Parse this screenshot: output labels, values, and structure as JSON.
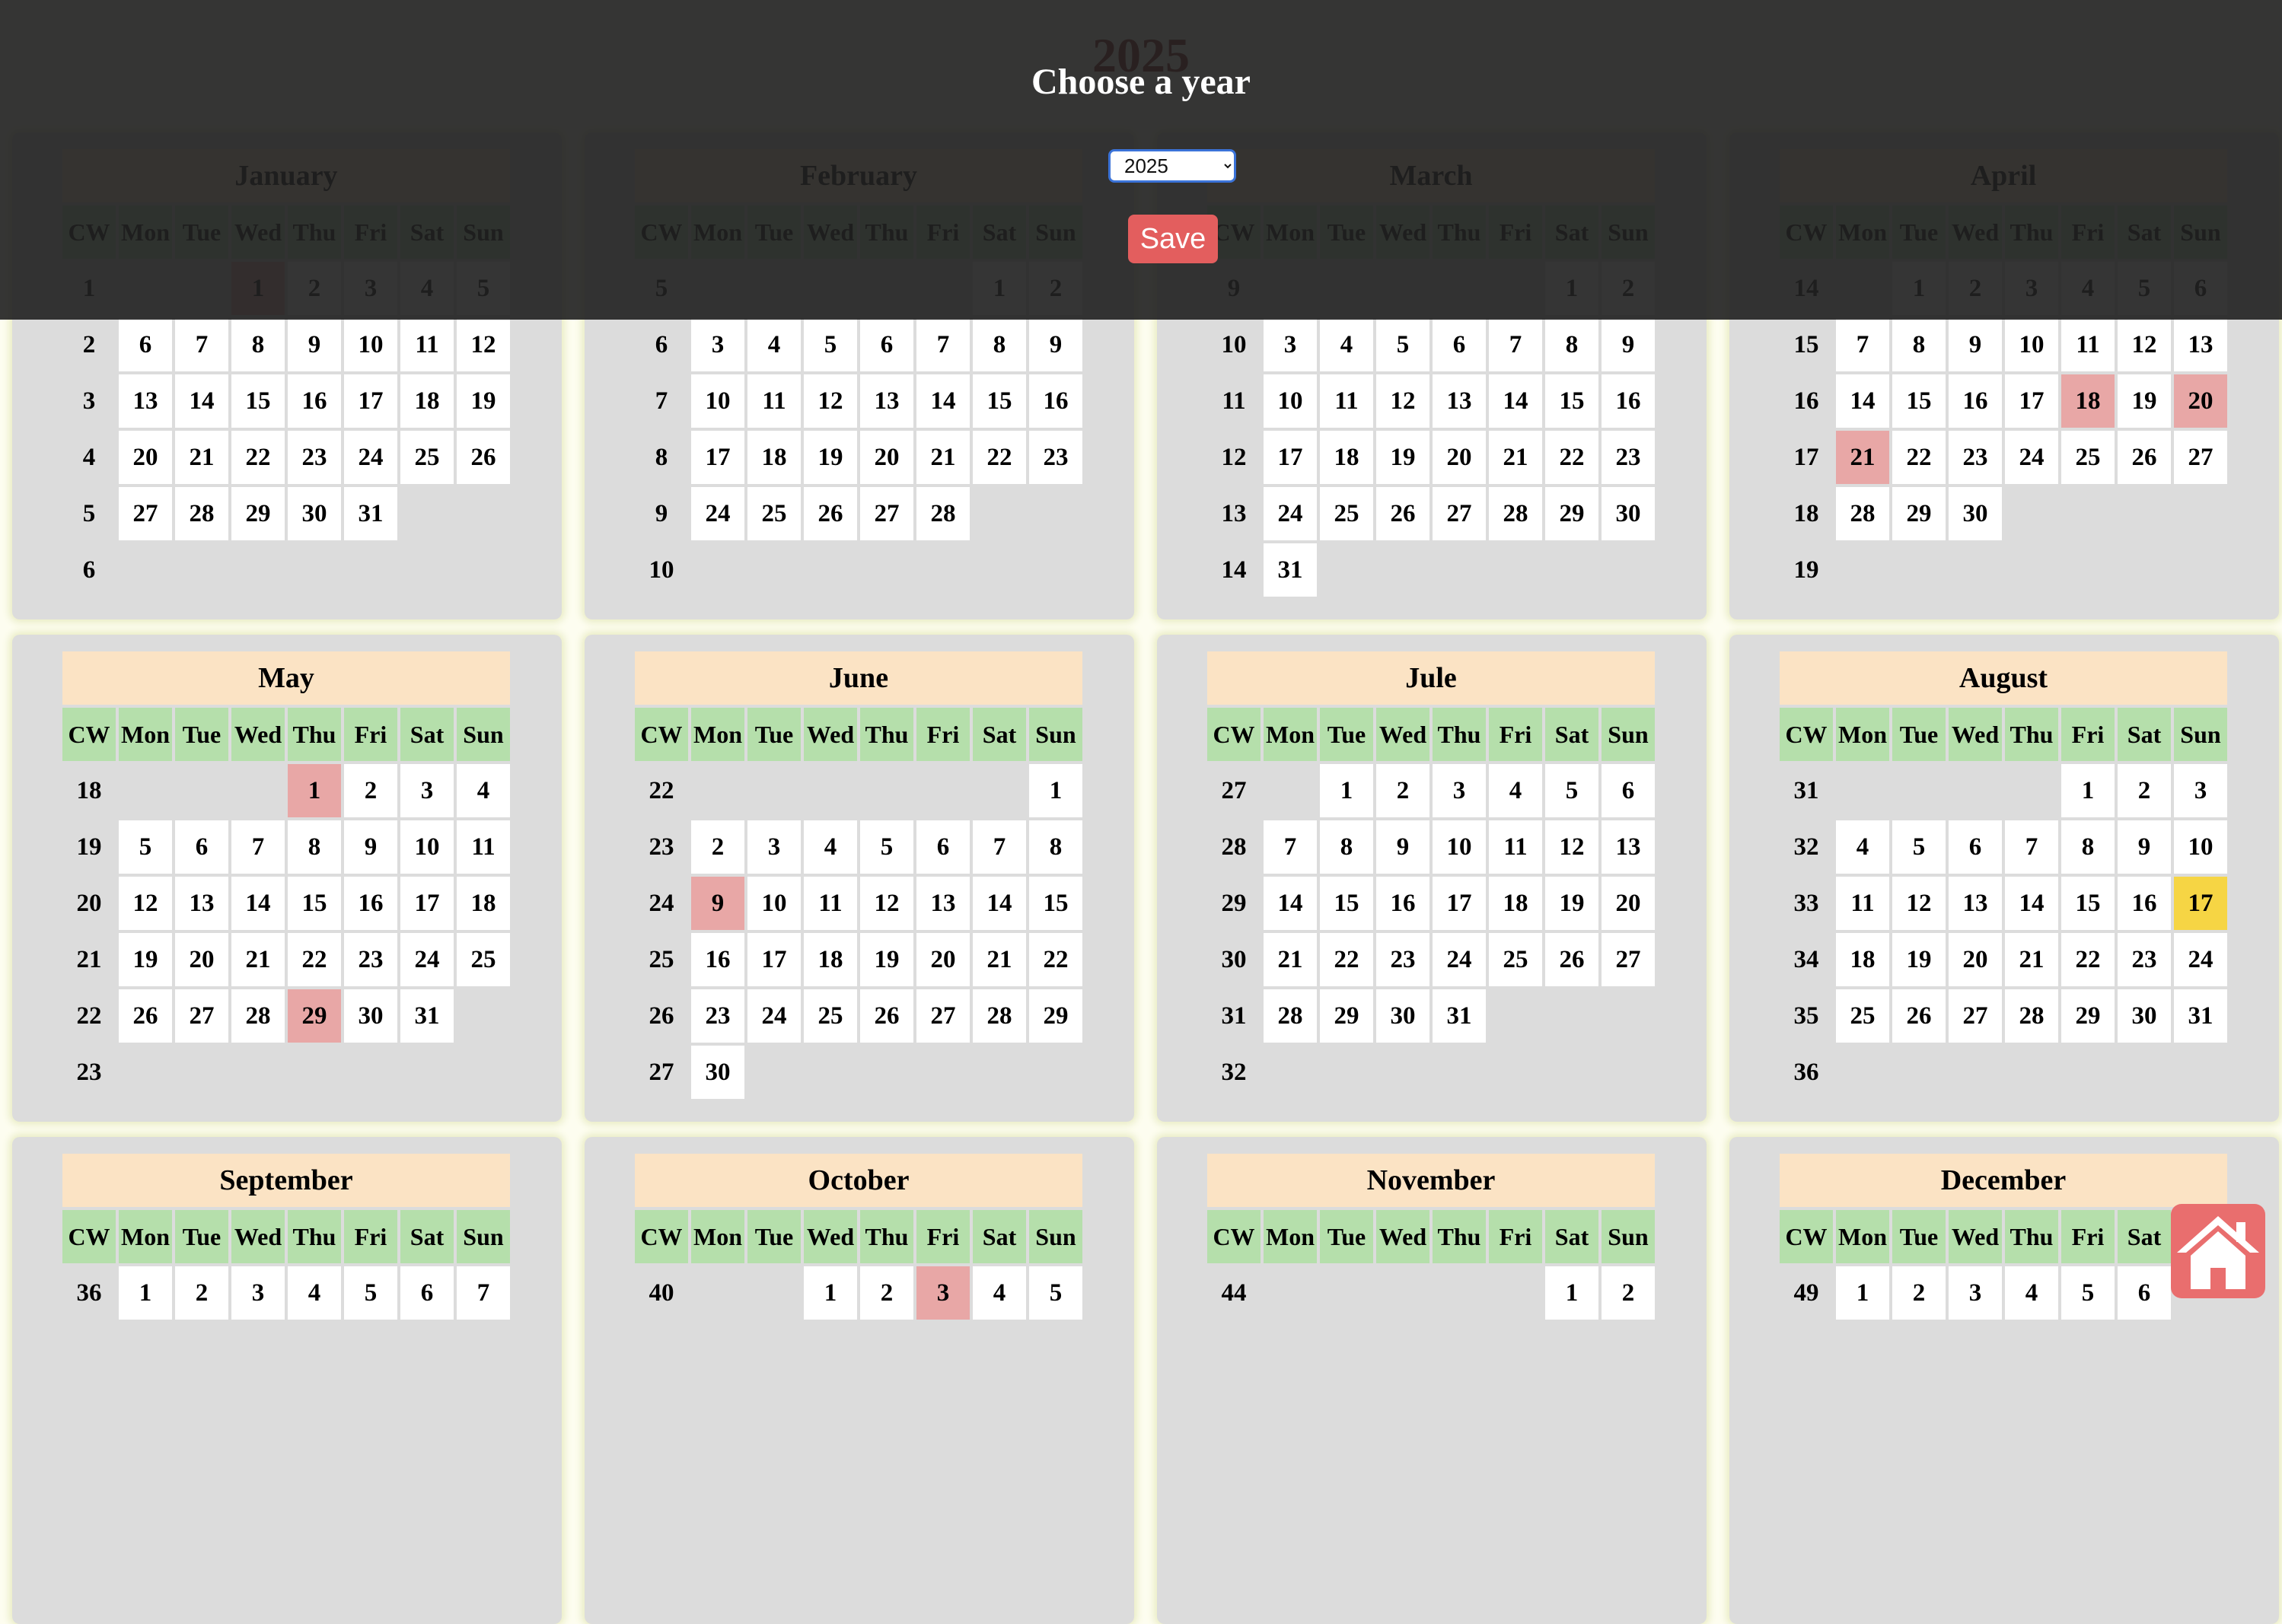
{
  "page": {
    "title": "2025"
  },
  "calendar": {
    "weekday_headers": [
      "CW",
      "Mon",
      "Tue",
      "Wed",
      "Thu",
      "Fri",
      "Sat",
      "Sun"
    ],
    "months": [
      {
        "name": "January",
        "weeks": [
          {
            "cw": "1",
            "days": [
              "",
              "",
              "1",
              "2",
              "3",
              "4",
              "5"
            ],
            "holidays": [
              "1"
            ]
          },
          {
            "cw": "2",
            "days": [
              "6",
              "7",
              "8",
              "9",
              "10",
              "11",
              "12"
            ]
          },
          {
            "cw": "3",
            "days": [
              "13",
              "14",
              "15",
              "16",
              "17",
              "18",
              "19"
            ]
          },
          {
            "cw": "4",
            "days": [
              "20",
              "21",
              "22",
              "23",
              "24",
              "25",
              "26"
            ]
          },
          {
            "cw": "5",
            "days": [
              "27",
              "28",
              "29",
              "30",
              "31",
              "",
              ""
            ]
          },
          {
            "cw": "6",
            "days": [
              "",
              "",
              "",
              "",
              "",
              "",
              ""
            ]
          }
        ]
      },
      {
        "name": "February",
        "weeks": [
          {
            "cw": "5",
            "days": [
              "",
              "",
              "",
              "",
              "",
              "1",
              "2"
            ]
          },
          {
            "cw": "6",
            "days": [
              "3",
              "4",
              "5",
              "6",
              "7",
              "8",
              "9"
            ]
          },
          {
            "cw": "7",
            "days": [
              "10",
              "11",
              "12",
              "13",
              "14",
              "15",
              "16"
            ]
          },
          {
            "cw": "8",
            "days": [
              "17",
              "18",
              "19",
              "20",
              "21",
              "22",
              "23"
            ]
          },
          {
            "cw": "9",
            "days": [
              "24",
              "25",
              "26",
              "27",
              "28",
              "",
              ""
            ]
          },
          {
            "cw": "10",
            "days": [
              "",
              "",
              "",
              "",
              "",
              "",
              ""
            ]
          }
        ]
      },
      {
        "name": "March",
        "weeks": [
          {
            "cw": "9",
            "days": [
              "",
              "",
              "",
              "",
              "",
              "1",
              "2"
            ]
          },
          {
            "cw": "10",
            "days": [
              "3",
              "4",
              "5",
              "6",
              "7",
              "8",
              "9"
            ]
          },
          {
            "cw": "11",
            "days": [
              "10",
              "11",
              "12",
              "13",
              "14",
              "15",
              "16"
            ]
          },
          {
            "cw": "12",
            "days": [
              "17",
              "18",
              "19",
              "20",
              "21",
              "22",
              "23"
            ]
          },
          {
            "cw": "13",
            "days": [
              "24",
              "25",
              "26",
              "27",
              "28",
              "29",
              "30"
            ]
          },
          {
            "cw": "14",
            "days": [
              "31",
              "",
              "",
              "",
              "",
              "",
              ""
            ]
          }
        ]
      },
      {
        "name": "April",
        "weeks": [
          {
            "cw": "14",
            "days": [
              "",
              "1",
              "2",
              "3",
              "4",
              "5",
              "6"
            ]
          },
          {
            "cw": "15",
            "days": [
              "7",
              "8",
              "9",
              "10",
              "11",
              "12",
              "13"
            ]
          },
          {
            "cw": "16",
            "days": [
              "14",
              "15",
              "16",
              "17",
              "18",
              "19",
              "20"
            ],
            "holidays": [
              "18",
              "20"
            ]
          },
          {
            "cw": "17",
            "days": [
              "21",
              "22",
              "23",
              "24",
              "25",
              "26",
              "27"
            ],
            "holidays": [
              "21"
            ]
          },
          {
            "cw": "18",
            "days": [
              "28",
              "29",
              "30",
              "",
              "",
              "",
              ""
            ]
          },
          {
            "cw": "19",
            "days": [
              "",
              "",
              "",
              "",
              "",
              "",
              ""
            ]
          }
        ]
      },
      {
        "name": "May",
        "weeks": [
          {
            "cw": "18",
            "days": [
              "",
              "",
              "",
              "1",
              "2",
              "3",
              "4"
            ],
            "holidays": [
              "1"
            ]
          },
          {
            "cw": "19",
            "days": [
              "5",
              "6",
              "7",
              "8",
              "9",
              "10",
              "11"
            ]
          },
          {
            "cw": "20",
            "days": [
              "12",
              "13",
              "14",
              "15",
              "16",
              "17",
              "18"
            ]
          },
          {
            "cw": "21",
            "days": [
              "19",
              "20",
              "21",
              "22",
              "23",
              "24",
              "25"
            ]
          },
          {
            "cw": "22",
            "days": [
              "26",
              "27",
              "28",
              "29",
              "30",
              "31",
              ""
            ],
            "holidays": [
              "29"
            ]
          },
          {
            "cw": "23",
            "days": [
              "",
              "",
              "",
              "",
              "",
              "",
              ""
            ]
          }
        ]
      },
      {
        "name": "June",
        "weeks": [
          {
            "cw": "22",
            "days": [
              "",
              "",
              "",
              "",
              "",
              "",
              "1"
            ]
          },
          {
            "cw": "23",
            "days": [
              "2",
              "3",
              "4",
              "5",
              "6",
              "7",
              "8"
            ]
          },
          {
            "cw": "24",
            "days": [
              "9",
              "10",
              "11",
              "12",
              "13",
              "14",
              "15"
            ],
            "holidays": [
              "9"
            ]
          },
          {
            "cw": "25",
            "days": [
              "16",
              "17",
              "18",
              "19",
              "20",
              "21",
              "22"
            ]
          },
          {
            "cw": "26",
            "days": [
              "23",
              "24",
              "25",
              "26",
              "27",
              "28",
              "29"
            ]
          },
          {
            "cw": "27",
            "days": [
              "30",
              "",
              "",
              "",
              "",
              "",
              ""
            ]
          }
        ]
      },
      {
        "name": "Jule",
        "weeks": [
          {
            "cw": "27",
            "days": [
              "",
              "1",
              "2",
              "3",
              "4",
              "5",
              "6"
            ]
          },
          {
            "cw": "28",
            "days": [
              "7",
              "8",
              "9",
              "10",
              "11",
              "12",
              "13"
            ]
          },
          {
            "cw": "29",
            "days": [
              "14",
              "15",
              "16",
              "17",
              "18",
              "19",
              "20"
            ]
          },
          {
            "cw": "30",
            "days": [
              "21",
              "22",
              "23",
              "24",
              "25",
              "26",
              "27"
            ]
          },
          {
            "cw": "31",
            "days": [
              "28",
              "29",
              "30",
              "31",
              "",
              "",
              ""
            ]
          },
          {
            "cw": "32",
            "days": [
              "",
              "",
              "",
              "",
              "",
              "",
              ""
            ]
          }
        ]
      },
      {
        "name": "August",
        "weeks": [
          {
            "cw": "31",
            "days": [
              "",
              "",
              "",
              "",
              "1",
              "2",
              "3"
            ]
          },
          {
            "cw": "32",
            "days": [
              "4",
              "5",
              "6",
              "7",
              "8",
              "9",
              "10"
            ]
          },
          {
            "cw": "33",
            "days": [
              "11",
              "12",
              "13",
              "14",
              "15",
              "16",
              "17"
            ],
            "today": "17"
          },
          {
            "cw": "34",
            "days": [
              "18",
              "19",
              "20",
              "21",
              "22",
              "23",
              "24"
            ]
          },
          {
            "cw": "35",
            "days": [
              "25",
              "26",
              "27",
              "28",
              "29",
              "30",
              "31"
            ]
          },
          {
            "cw": "36",
            "days": [
              "",
              "",
              "",
              "",
              "",
              "",
              ""
            ]
          }
        ]
      },
      {
        "name": "September",
        "weeks": [
          {
            "cw": "36",
            "days": [
              "1",
              "2",
              "3",
              "4",
              "5",
              "6",
              "7"
            ]
          }
        ]
      },
      {
        "name": "October",
        "weeks": [
          {
            "cw": "40",
            "days": [
              "",
              "",
              "1",
              "2",
              "3",
              "4",
              "5"
            ],
            "holidays": [
              "3"
            ]
          }
        ]
      },
      {
        "name": "November",
        "weeks": [
          {
            "cw": "44",
            "days": [
              "",
              "",
              "",
              "",
              "",
              "1",
              "2"
            ]
          }
        ]
      },
      {
        "name": "December",
        "weeks": [
          {
            "cw": "49",
            "days": [
              "1",
              "2",
              "3",
              "4",
              "5",
              "6",
              ""
            ]
          }
        ]
      }
    ]
  },
  "overlay": {
    "title": "Choose a year",
    "year_select": {
      "selected": "2025",
      "options": [
        "2025"
      ]
    },
    "save_label": "Save"
  },
  "colors": {
    "page_background": "#fdfdf0",
    "card_background": "#dcdcdc",
    "month_header": "#fbe3c4",
    "weekday_header": "#b5dfab",
    "holiday": "#e8a7a6",
    "today": "#f6d544",
    "title": "#7a1f1f",
    "overlay": "#212121",
    "save_button": "#e35e5e",
    "home_button": "#e96e6e"
  },
  "icons": {
    "home_button": "home-icon",
    "select_arrows": "chevron-up-down-icon"
  }
}
